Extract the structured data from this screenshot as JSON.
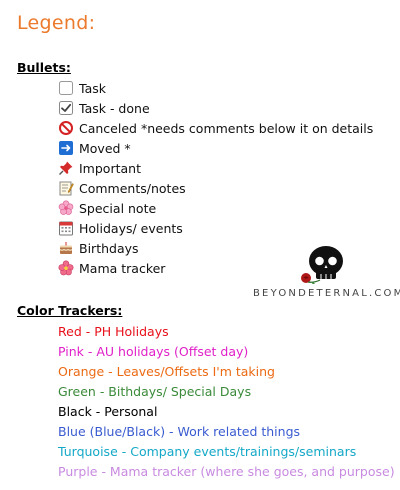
{
  "title": "Legend:",
  "bullets_heading": "Bullets:",
  "bullets": [
    {
      "icon": "empty-checkbox-icon",
      "label": "Task"
    },
    {
      "icon": "checked-checkbox-icon",
      "label": "Task - done"
    },
    {
      "icon": "no-entry-icon",
      "label": "Canceled *needs comments below it on details"
    },
    {
      "icon": "moved-arrow-icon",
      "label": "Moved *"
    },
    {
      "icon": "pushpin-icon",
      "label": "Important"
    },
    {
      "icon": "memo-icon",
      "label": "Comments/notes"
    },
    {
      "icon": "pink-flower-icon",
      "label": "Special note"
    },
    {
      "icon": "calendar-icon",
      "label": "Holidays/ events"
    },
    {
      "icon": "cake-icon",
      "label": "Birthdays"
    },
    {
      "icon": "hibiscus-icon",
      "label": "Mama tracker"
    }
  ],
  "colors_heading": "Color Trackers:",
  "color_trackers": [
    {
      "label": "Red - PH Holidays",
      "color": "#e8101a"
    },
    {
      "label": "Pink - AU holidays (Offset day)",
      "color": "#e020c8"
    },
    {
      "label": "Orange - Leaves/Offsets I'm taking",
      "color": "#ec6a14"
    },
    {
      "label": "Green - Bithdays/ Special Days",
      "color": "#3a8a3a"
    },
    {
      "label": "Black - Personal",
      "color": "#000000"
    },
    {
      "label": "Blue (Blue/Black) - Work related things",
      "color": "#3a5bd0"
    },
    {
      "label": "Turquoise - Company events/trainings/seminars",
      "color": "#14a8c8"
    },
    {
      "label": "Purple - Mama tracker (where she goes, and purpose)",
      "color": "#c88ae0"
    }
  ],
  "watermark_text": "BEYONDETERNAL.COM"
}
